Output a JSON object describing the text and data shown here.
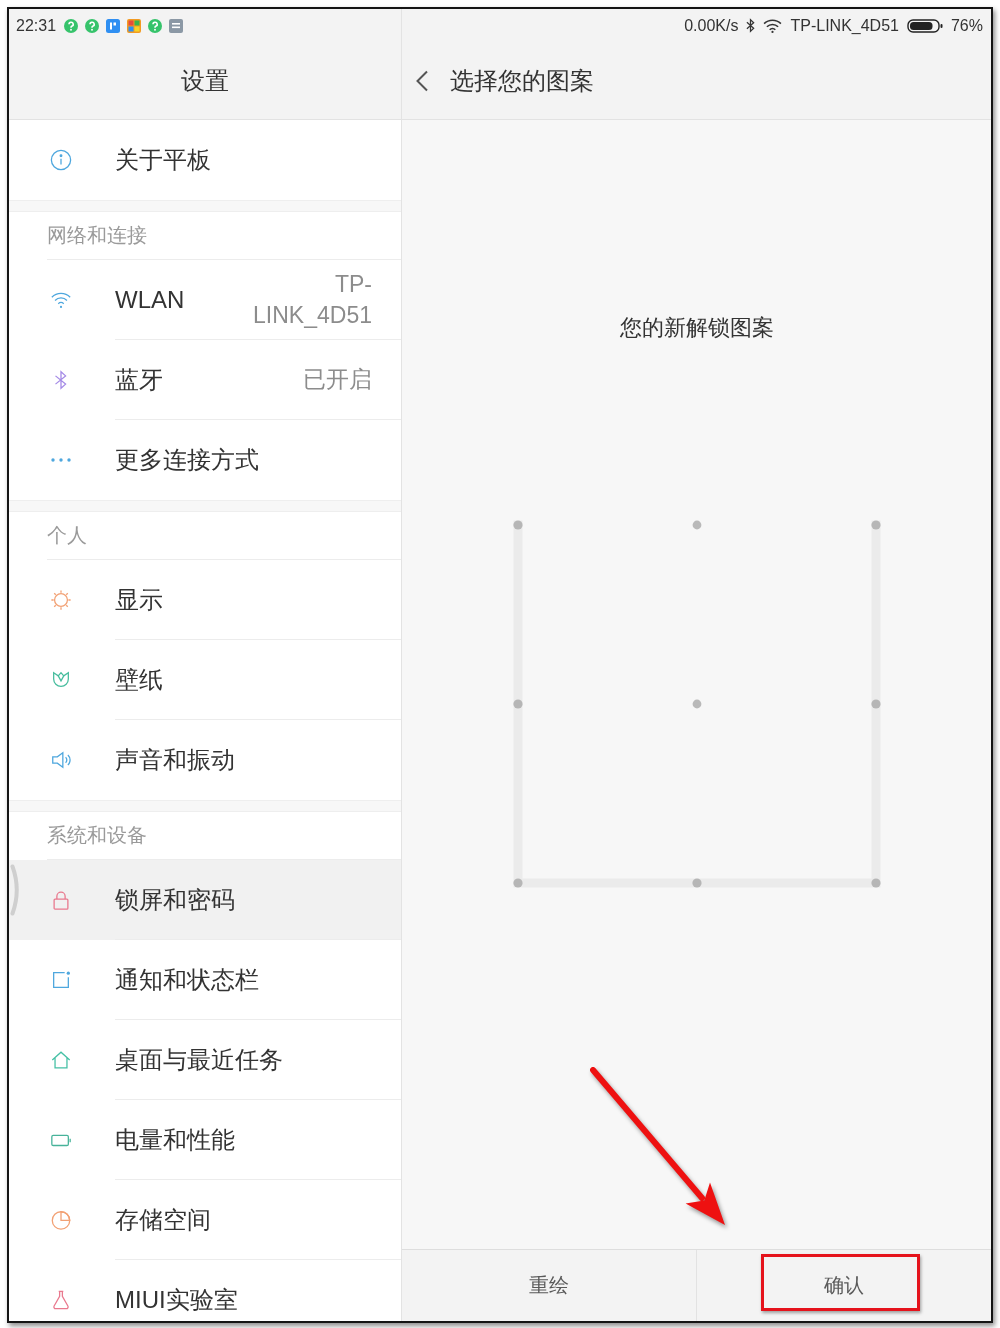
{
  "status_bar": {
    "time": "22:31",
    "speed": "0.00K/s",
    "network": "TP-LINK_4D51",
    "battery": "76%"
  },
  "sidebar": {
    "title": "设置",
    "sections": [
      {
        "items": [
          {
            "label": "关于平板",
            "selected": false
          }
        ]
      },
      {
        "header": "网络和连接",
        "items": [
          {
            "label": "WLAN",
            "value": "TP-LINK_4D51",
            "selected": false
          },
          {
            "label": "蓝牙",
            "value": "已开启",
            "selected": false
          },
          {
            "label": "更多连接方式",
            "selected": false
          }
        ]
      },
      {
        "header": "个人",
        "items": [
          {
            "label": "显示",
            "selected": false
          },
          {
            "label": "壁纸",
            "selected": false
          },
          {
            "label": "声音和振动",
            "selected": false
          }
        ]
      },
      {
        "header": "系统和设备",
        "items": [
          {
            "label": "锁屏和密码",
            "selected": true
          },
          {
            "label": "通知和状态栏",
            "selected": false
          },
          {
            "label": "桌面与最近任务",
            "selected": false
          },
          {
            "label": "电量和性能",
            "selected": false
          },
          {
            "label": "存储空间",
            "selected": false
          },
          {
            "label": "MIUI实验室",
            "selected": false
          }
        ]
      }
    ]
  },
  "page": {
    "title": "选择您的图案",
    "prompt": "您的新解锁图案",
    "pattern": {
      "dots": [
        {
          "selected": true
        },
        {
          "selected": false
        },
        {
          "selected": true
        },
        {
          "selected": true
        },
        {
          "selected": false
        },
        {
          "selected": true
        },
        {
          "selected": true
        },
        {
          "selected": true
        },
        {
          "selected": true
        }
      ]
    },
    "buttons": [
      {
        "label": "重绘",
        "highlighted": false
      },
      {
        "label": "确认",
        "highlighted": true
      }
    ]
  },
  "annotations": {
    "arrow": true
  }
}
